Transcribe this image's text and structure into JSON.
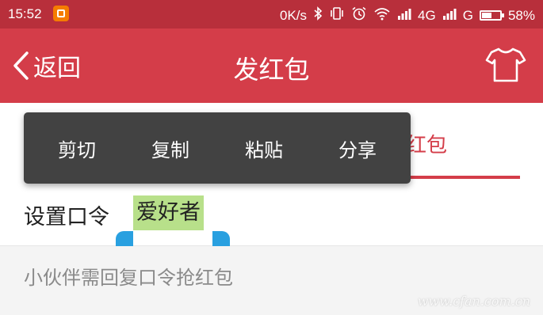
{
  "status_bar": {
    "time": "15:52",
    "network_speed": "0K/s",
    "signal1_label": "4G",
    "signal2_label": "G",
    "battery_percent": "58%",
    "battery_level": 0.58,
    "icons": [
      "app-notification-icon",
      "bluetooth-icon",
      "vibrate-icon",
      "alarm-icon",
      "wifi-icon",
      "signal-icon",
      "battery-icon"
    ]
  },
  "app_bar": {
    "back_label": "返回",
    "title": "发红包",
    "right_icon": "tshirt-icon"
  },
  "tabs": {
    "active_partial_label": "红包"
  },
  "password_row": {
    "label": "设置口令",
    "value": "爱好者"
  },
  "hint": "小伙伴需回复口令抢红包",
  "context_menu": {
    "items": [
      "剪切",
      "复制",
      "粘贴",
      "分享"
    ]
  },
  "watermark": "www.cfan.com.cn",
  "colors": {
    "status_bar": "#b82f3b",
    "app_bar": "#d43d49",
    "accent": "#d43d49",
    "selection": "#b8e08a",
    "handle": "#29a0e0",
    "menu_bg": "#424242"
  }
}
